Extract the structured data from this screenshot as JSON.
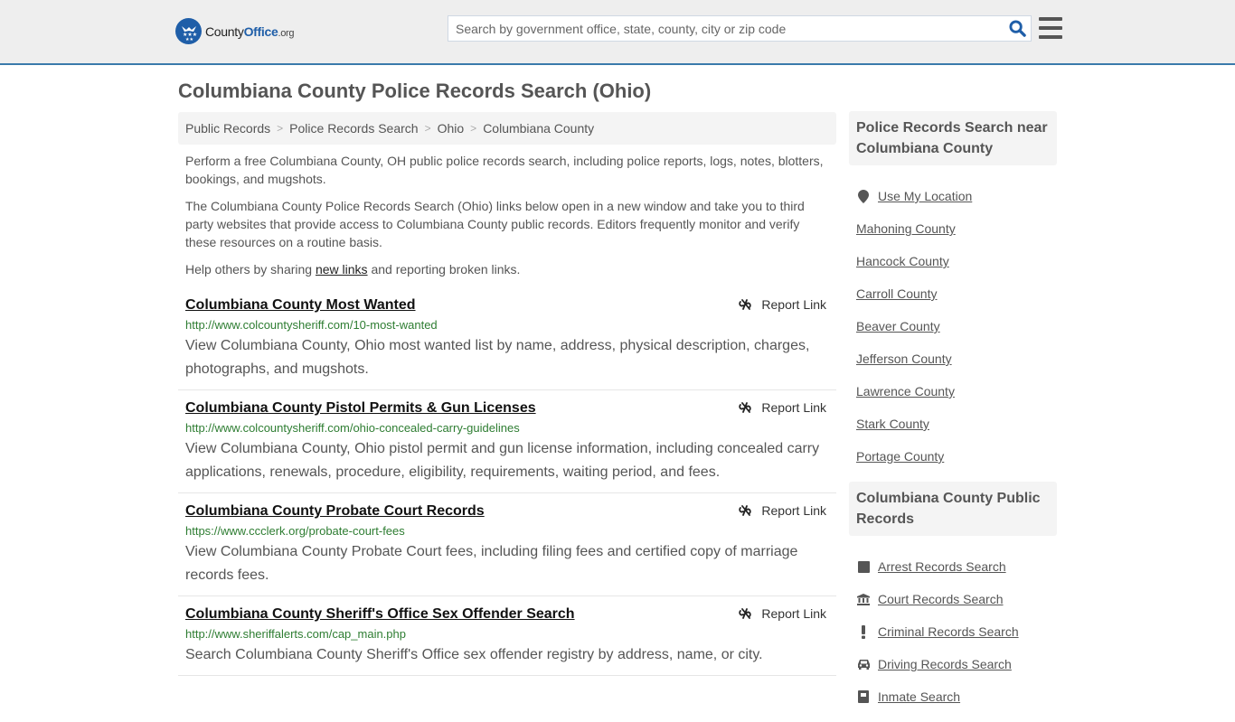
{
  "header": {
    "logo": {
      "county": "County",
      "office": "Office",
      "org": ".org"
    },
    "search": {
      "placeholder": "Search by government office, state, county, city or zip code",
      "value": ""
    },
    "colors": {
      "brand": "#1f5ea8",
      "accent_border": "#3a7aab"
    }
  },
  "page_title": "Columbiana County Police Records Search (Ohio)",
  "breadcrumb": [
    {
      "label": "Public Records"
    },
    {
      "label": "Police Records Search"
    },
    {
      "label": "Ohio"
    },
    {
      "label": "Columbiana County"
    }
  ],
  "intro": {
    "p1": "Perform a free Columbiana County, OH public police records search, including police reports, logs, notes, blotters, bookings, and mugshots.",
    "p2": "The Columbiana County Police Records Search (Ohio) links below open in a new window and take you to third party websites that provide access to Columbiana County public records. Editors frequently monitor and verify these resources on a routine basis.",
    "p3_before": "Help others by sharing ",
    "p3_link": "new links",
    "p3_after": " and reporting broken links."
  },
  "results": [
    {
      "title": "Columbiana County Most Wanted",
      "url": "http://www.colcountysheriff.com/10-most-wanted",
      "description": "View Columbiana County, Ohio most wanted list by name, address, physical description, charges, photographs, and mugshots.",
      "report_label": "Report Link"
    },
    {
      "title": "Columbiana County Pistol Permits & Gun Licenses",
      "url": "http://www.colcountysheriff.com/ohio-concealed-carry-guidelines",
      "description": "View Columbiana County, Ohio pistol permit and gun license information, including concealed carry applications, renewals, procedure, eligibility, requirements, waiting period, and fees.",
      "report_label": "Report Link"
    },
    {
      "title": "Columbiana County Probate Court Records",
      "url": "https://www.ccclerk.org/probate-court-fees",
      "description": "View Columbiana County Probate Court fees, including filing fees and certified copy of marriage records fees.",
      "report_label": "Report Link"
    },
    {
      "title": "Columbiana County Sheriff's Office Sex Offender Search",
      "url": "http://www.sheriffalerts.com/cap_main.php",
      "description": "Search Columbiana County Sheriff's Office sex offender registry by address, name, or city.",
      "report_label": "Report Link"
    }
  ],
  "sidebar": {
    "nearby": {
      "title": "Police Records Search near Columbiana County",
      "use_location": {
        "label": "Use My Location",
        "icon": "map-marker-icon"
      },
      "items": [
        {
          "label": "Mahoning County"
        },
        {
          "label": "Hancock County"
        },
        {
          "label": "Carroll County"
        },
        {
          "label": "Beaver County"
        },
        {
          "label": "Jefferson County"
        },
        {
          "label": "Lawrence County"
        },
        {
          "label": "Stark County"
        },
        {
          "label": "Portage County"
        }
      ]
    },
    "public_records": {
      "title": "Columbiana County Public Records",
      "items": [
        {
          "label": "Arrest Records Search",
          "icon": "square-icon"
        },
        {
          "label": "Court Records Search",
          "icon": "courthouse-icon"
        },
        {
          "label": "Criminal Records Search",
          "icon": "exclamation-icon"
        },
        {
          "label": "Driving Records Search",
          "icon": "car-icon"
        },
        {
          "label": "Inmate Search",
          "icon": "inmate-icon"
        }
      ]
    }
  }
}
